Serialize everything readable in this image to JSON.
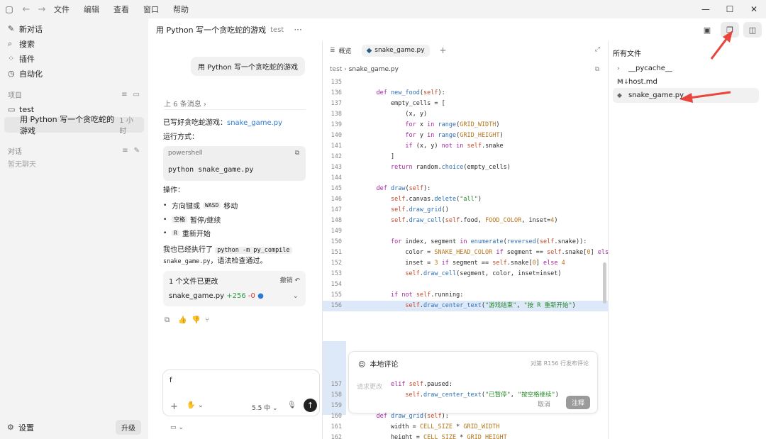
{
  "menu": [
    "文件",
    "编辑",
    "查看",
    "窗口",
    "帮助"
  ],
  "sidebar": {
    "new_chat": "新对话",
    "search": "搜索",
    "plugins": "插件",
    "automation": "自动化",
    "projects_label": "项目",
    "project_name": "test",
    "thread_title": "用 Python 写一个贪吃蛇的游戏",
    "thread_time": "1 小时",
    "chats_label": "对话",
    "no_chats": "暂无聊天",
    "settings": "设置",
    "upgrade": "升级"
  },
  "header": {
    "title": "用 Python 写一个贪吃蛇的游戏",
    "project": "test"
  },
  "chat": {
    "user_message": "用 Python 写一个贪吃蛇的游戏",
    "prev_messages": "上 6 条消息",
    "done_text": "已写好贪吃蛇游戏：",
    "done_link": "snake_game.py",
    "run_label": "运行方式：",
    "code_lang": "powershell",
    "code_cmd": "python snake_game.py",
    "ops_label": "操作：",
    "bullets": [
      {
        "key": "方向键或",
        "code": "WASD",
        "text": "移动"
      },
      {
        "key": "",
        "code": "空格",
        "text": "暂停/继续"
      },
      {
        "key": "",
        "code": "R",
        "text": "重新开始"
      }
    ],
    "compile_pre": "我也已经执行了",
    "compile_code1": "python -m py_compile",
    "compile_code2": "snake_game.py",
    "compile_post": "，语法检查通过。",
    "files_changed": "1 个文件已更改",
    "undo": "撤销",
    "changed_file": "snake_game.py",
    "added": "+256",
    "removed": "-0",
    "composer_value": "f",
    "model": "5.5 中"
  },
  "editor": {
    "tabs": [
      "概览",
      "snake_game.py"
    ],
    "crumb_parent": "test",
    "crumb_file": "snake_game.py",
    "comment_title": "本地评论",
    "comment_hint": "对第 R156 行发布评论",
    "comment_placeholder": "请求更改",
    "comment_cancel": "取消",
    "comment_submit": "注释"
  },
  "files": {
    "header": "所有文件",
    "items": [
      "__pycache__",
      "host.md",
      "snake_game.py"
    ]
  },
  "code_lines": [
    {
      "n": "135",
      "t": ""
    },
    {
      "n": "136",
      "t": "    def new_food(self):"
    },
    {
      "n": "137",
      "t": "        empty_cells = ["
    },
    {
      "n": "138",
      "t": "            (x, y)"
    },
    {
      "n": "139",
      "t": "            for x in range(GRID_WIDTH)"
    },
    {
      "n": "140",
      "t": "            for y in range(GRID_HEIGHT)"
    },
    {
      "n": "141",
      "t": "            if (x, y) not in self.snake"
    },
    {
      "n": "142",
      "t": "        ]"
    },
    {
      "n": "143",
      "t": "        return random.choice(empty_cells)"
    },
    {
      "n": "144",
      "t": ""
    },
    {
      "n": "145",
      "t": "    def draw(self):"
    },
    {
      "n": "146",
      "t": "        self.canvas.delete(\"all\")"
    },
    {
      "n": "147",
      "t": "        self.draw_grid()"
    },
    {
      "n": "148",
      "t": "        self.draw_cell(self.food, FOOD_COLOR, inset=4)"
    },
    {
      "n": "149",
      "t": ""
    },
    {
      "n": "150",
      "t": "        for index, segment in enumerate(reversed(self.snake)):"
    },
    {
      "n": "151",
      "t": "            color = SNAKE_HEAD_COLOR if segment == self.snake[0] else SNAKE_C"
    },
    {
      "n": "152",
      "t": "            inset = 3 if segment == self.snake[0] else 4"
    },
    {
      "n": "153",
      "t": "            self.draw_cell(segment, color, inset=inset)"
    },
    {
      "n": "154",
      "t": ""
    },
    {
      "n": "155",
      "t": "        if not self.running:"
    },
    {
      "n": "156",
      "t": "            self.draw_center_text(\"游戏结束\", \"按 R 重新开始\")"
    },
    {
      "n": "157",
      "t": "        elif self.paused:"
    },
    {
      "n": "158",
      "t": "            self.draw_center_text(\"已暂停\", \"按空格继续\")"
    },
    {
      "n": "159",
      "t": ""
    },
    {
      "n": "160",
      "t": "    def draw_grid(self):"
    },
    {
      "n": "161",
      "t": "        width = CELL_SIZE * GRID_WIDTH"
    },
    {
      "n": "162",
      "t": "        height = CELL_SIZE * GRID_HEIGHT"
    }
  ],
  "colors": {
    "accent": "#2d7ad6",
    "annotation": "#e8453c",
    "highlight": "#dde9f8"
  }
}
